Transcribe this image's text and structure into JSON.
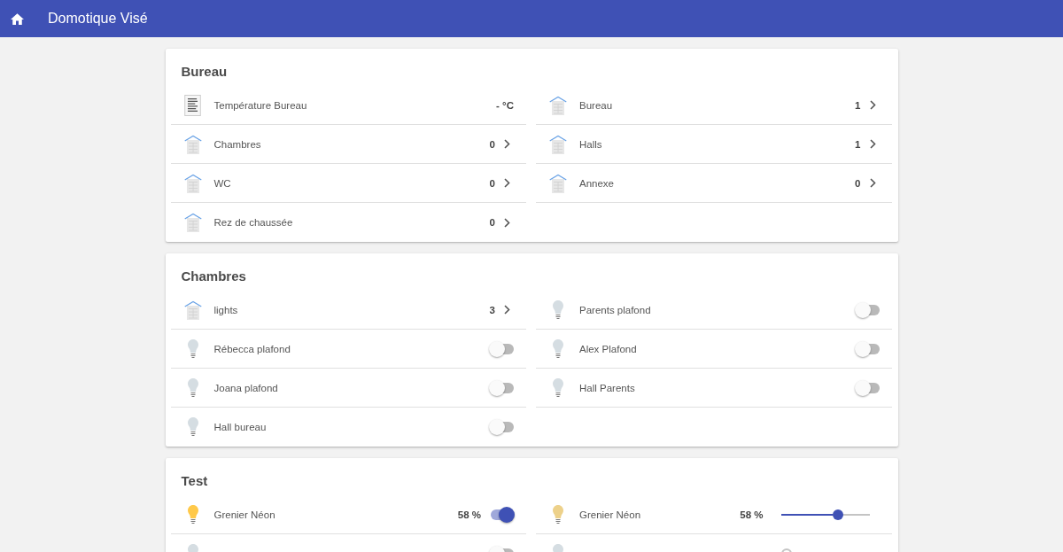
{
  "app_bar": {
    "title": "Domotique Visé"
  },
  "sections": [
    {
      "title": "Bureau",
      "items": [
        {
          "kind": "sensor",
          "label": "Température Bureau",
          "value": "- °C"
        },
        {
          "kind": "group",
          "label": "Bureau",
          "count": "1"
        },
        {
          "kind": "group",
          "label": "Chambres",
          "count": "0"
        },
        {
          "kind": "group",
          "label": "Halls",
          "count": "1"
        },
        {
          "kind": "group",
          "label": "WC",
          "count": "0"
        },
        {
          "kind": "group",
          "label": "Annexe",
          "count": "0"
        },
        {
          "kind": "group",
          "label": "Rez de chaussée",
          "count": "0"
        }
      ]
    },
    {
      "title": "Chambres",
      "items": [
        {
          "kind": "group",
          "label": "lights",
          "count": "3"
        },
        {
          "kind": "switch",
          "label": "Parents plafond",
          "on": false
        },
        {
          "kind": "switch",
          "label": "Rébecca plafond",
          "on": false
        },
        {
          "kind": "switch",
          "label": "Alex Plafond",
          "on": false
        },
        {
          "kind": "switch",
          "label": "Joana plafond",
          "on": false
        },
        {
          "kind": "switch",
          "label": "Hall Parents",
          "on": false
        },
        {
          "kind": "switch",
          "label": "Hall bureau",
          "on": false
        }
      ]
    },
    {
      "title": "Test",
      "items": [
        {
          "kind": "switch",
          "label": "Grenier Néon",
          "reading": "58 %",
          "on": true
        },
        {
          "kind": "dimmer",
          "label": "Grenier Néon",
          "reading": "58 %",
          "level": 0.58
        },
        {
          "kind": "switch",
          "on": false
        },
        {
          "kind": "dimmer",
          "level": 0
        }
      ]
    }
  ]
}
